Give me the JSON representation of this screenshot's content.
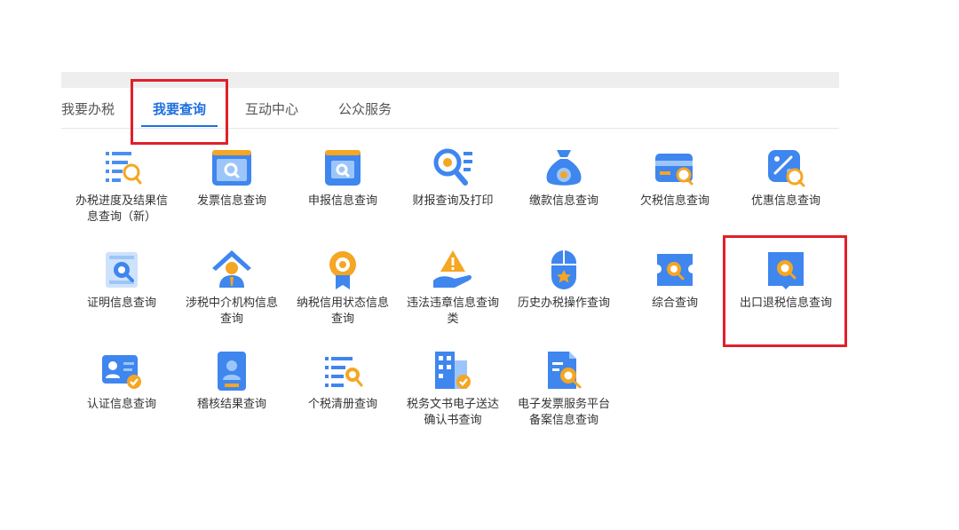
{
  "tabs": [
    {
      "label": "我要办税",
      "active": false
    },
    {
      "label": "我要查询",
      "active": true
    },
    {
      "label": "互动中心",
      "active": false
    },
    {
      "label": "公众服务",
      "active": false
    }
  ],
  "accent_color": "#1e6fe0",
  "highlight_color": "#e0202a",
  "items": [
    {
      "label": "办税进度及结果信息查询（新）",
      "icon": "progress-list-search-icon"
    },
    {
      "label": "发票信息查询",
      "icon": "invoice-search-icon"
    },
    {
      "label": "申报信息查询",
      "icon": "declaration-search-icon"
    },
    {
      "label": "财报查询及打印",
      "icon": "financial-report-search-icon"
    },
    {
      "label": "缴款信息查询",
      "icon": "payment-bag-icon"
    },
    {
      "label": "欠税信息查询",
      "icon": "arrears-card-icon"
    },
    {
      "label": "优惠信息查询",
      "icon": "discount-tag-icon"
    },
    {
      "label": "证明信息查询",
      "icon": "certificate-search-icon"
    },
    {
      "label": "涉税中介机构信息查询",
      "icon": "agency-person-icon"
    },
    {
      "label": "纳税信用状态信息查询",
      "icon": "credit-medal-icon"
    },
    {
      "label": "违法违章信息查询类",
      "icon": "violation-warning-icon"
    },
    {
      "label": "历史办税操作查询",
      "icon": "history-mouse-icon"
    },
    {
      "label": "综合查询",
      "icon": "comprehensive-search-icon"
    },
    {
      "label": "出口退税信息查询",
      "icon": "export-refund-search-icon"
    },
    {
      "label": "认证信息查询",
      "icon": "authentication-card-icon"
    },
    {
      "label": "稽核结果查询",
      "icon": "audit-badge-icon"
    },
    {
      "label": "个税清册查询",
      "icon": "personal-tax-list-icon"
    },
    {
      "label": "税务文书电子送达确认书查询",
      "icon": "tax-document-building-icon"
    },
    {
      "label": "电子发票服务平台备案信息查询",
      "icon": "e-invoice-platform-icon"
    }
  ]
}
